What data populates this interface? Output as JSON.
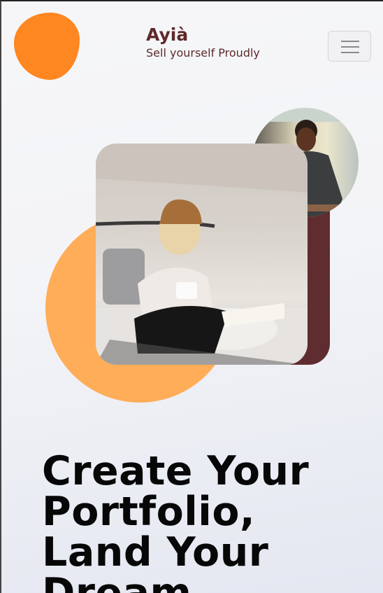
{
  "header": {
    "brand_title": "Ayià",
    "tagline": "Sell yourself Proudly",
    "menu_icon": "hamburger-icon"
  },
  "hero": {
    "heading": "Create Your Portfolio, Land Your Dream"
  },
  "colors": {
    "logo": "#fe8721",
    "brand_text": "#5e2a2b",
    "accent_orange": "#ffad58",
    "accent_maroon": "#5f2c2f"
  }
}
